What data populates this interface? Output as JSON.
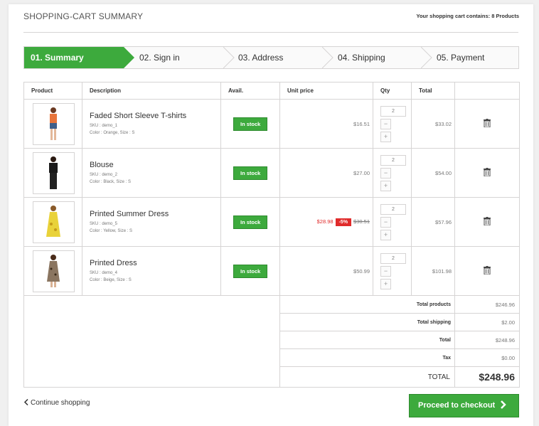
{
  "header": {
    "title": "SHOPPING-CART SUMMARY",
    "cart_count_text": "Your shopping cart contains: 8 Products"
  },
  "steps": [
    {
      "label": "01. Summary",
      "active": true
    },
    {
      "label": "02. Sign in",
      "active": false
    },
    {
      "label": "03. Address",
      "active": false
    },
    {
      "label": "04. Shipping",
      "active": false
    },
    {
      "label": "05. Payment",
      "active": false
    }
  ],
  "table": {
    "headers": {
      "product": "Product",
      "description": "Description",
      "avail": "Avail.",
      "unit_price": "Unit price",
      "qty": "Qty",
      "total": "Total"
    },
    "rows": [
      {
        "name": "Faded Short Sleeve T-shirts",
        "sku": "SKU : demo_1",
        "attrs": "Color : Orange, Size : S",
        "avail": "In stock",
        "price": "$16.51",
        "qty": "2",
        "total": "$33.02",
        "thumb_color": "#e8743b"
      },
      {
        "name": "Blouse",
        "sku": "SKU : demo_2",
        "attrs": "Color : Black, Size : S",
        "avail": "In stock",
        "price": "$27.00",
        "qty": "2",
        "total": "$54.00",
        "thumb_color": "#1a1a1a"
      },
      {
        "name": "Printed Summer Dress",
        "sku": "SKU : demo_5",
        "attrs": "Color : Yellow, Size : S",
        "avail": "In stock",
        "price": "$28.98",
        "discount": "-5%",
        "old_price": "$30.51",
        "qty": "2",
        "total": "$57.96",
        "thumb_color": "#e9d23a"
      },
      {
        "name": "Printed Dress",
        "sku": "SKU : demo_4",
        "attrs": "Color : Beige, Size : S",
        "avail": "In stock",
        "price": "$50.99",
        "qty": "2",
        "total": "$101.98",
        "thumb_color": "#8a7560"
      }
    ],
    "summary": {
      "total_products_label": "Total products",
      "total_products": "$246.96",
      "total_shipping_label": "Total shipping",
      "total_shipping": "$2.00",
      "total_label": "Total",
      "total": "$248.96",
      "tax_label": "Tax",
      "tax": "$0.00",
      "grand_total_label": "TOTAL",
      "grand_total": "$248.96"
    }
  },
  "qty_minus": "−",
  "qty_plus": "+",
  "continue_label": "Continue shopping",
  "checkout_label": "Proceed to checkout",
  "colors": {
    "accent": "#3daa3d",
    "sale": "#e02b2b"
  }
}
